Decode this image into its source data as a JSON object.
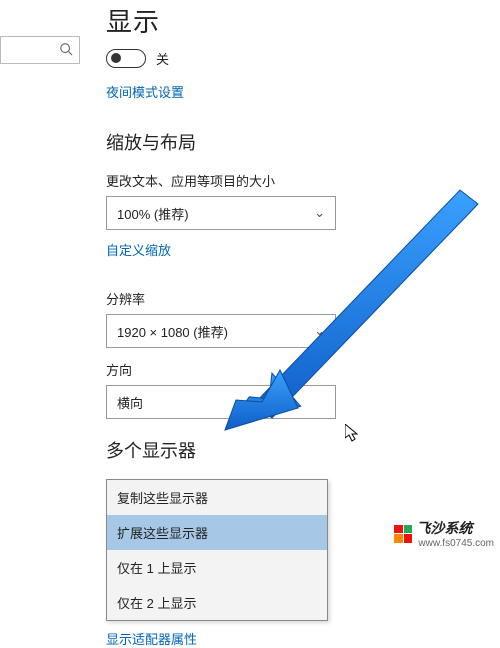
{
  "page_title": "显示",
  "toggle": {
    "state_label": "关"
  },
  "night_mode_link": "夜间模式设置",
  "scale_section": {
    "heading": "缩放与布局",
    "text_size_label": "更改文本、应用等项目的大小",
    "text_size_value": "100% (推荐)",
    "custom_scale_link": "自定义缩放",
    "resolution_label": "分辨率",
    "resolution_value": "1920 × 1080 (推荐)",
    "orientation_label": "方向",
    "orientation_value": "横向"
  },
  "multi_display": {
    "heading": "多个显示器",
    "options": [
      "复制这些显示器",
      "扩展这些显示器",
      "仅在 1 上显示",
      "仅在 2 上显示"
    ],
    "selected_index": 1,
    "adapter_link": "显示适配器属性"
  },
  "watermark": {
    "brand": "飞沙系统",
    "url": "www.fs0745.com"
  }
}
